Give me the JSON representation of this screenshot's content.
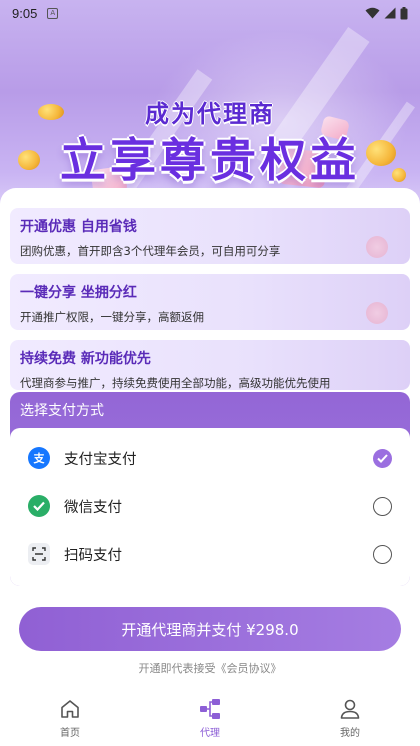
{
  "status_bar": {
    "time": "9:05"
  },
  "hero": {
    "subtitle": "成为代理商",
    "title": "立享尊贵权益"
  },
  "benefits": [
    {
      "title": "开通优惠 自用省钱",
      "desc": "团购优惠，首开即含3个代理年会员，可自用可分享"
    },
    {
      "title": "一键分享 坐拥分红",
      "desc": "开通推广权限，一键分享，高额返佣"
    },
    {
      "title": "持续免费 新功能优先",
      "desc": "代理商参与推广，持续免费使用全部功能，高级功能优先使用"
    }
  ],
  "payment": {
    "header": "选择支付方式",
    "options": [
      {
        "label": "支付宝支付",
        "icon": "alipay-icon",
        "selected": true,
        "color": "#1677ff"
      },
      {
        "label": "微信支付",
        "icon": "wechat-pay-icon",
        "selected": false,
        "color": "#2aae67"
      },
      {
        "label": "扫码支付",
        "icon": "scan-icon",
        "selected": false,
        "color": "#555555"
      }
    ]
  },
  "action": {
    "button_label": "开通代理商并支付 ¥298.0",
    "agreement": "开通即代表接受《会员协议》"
  },
  "bottom_nav": [
    {
      "label": "首页",
      "icon": "home-icon",
      "active": false
    },
    {
      "label": "代理",
      "icon": "agent-icon",
      "active": true
    },
    {
      "label": "我的",
      "icon": "profile-icon",
      "active": false
    }
  ],
  "colors": {
    "accent": "#9b6fe0",
    "brand_purple": "#6a2fe0"
  }
}
